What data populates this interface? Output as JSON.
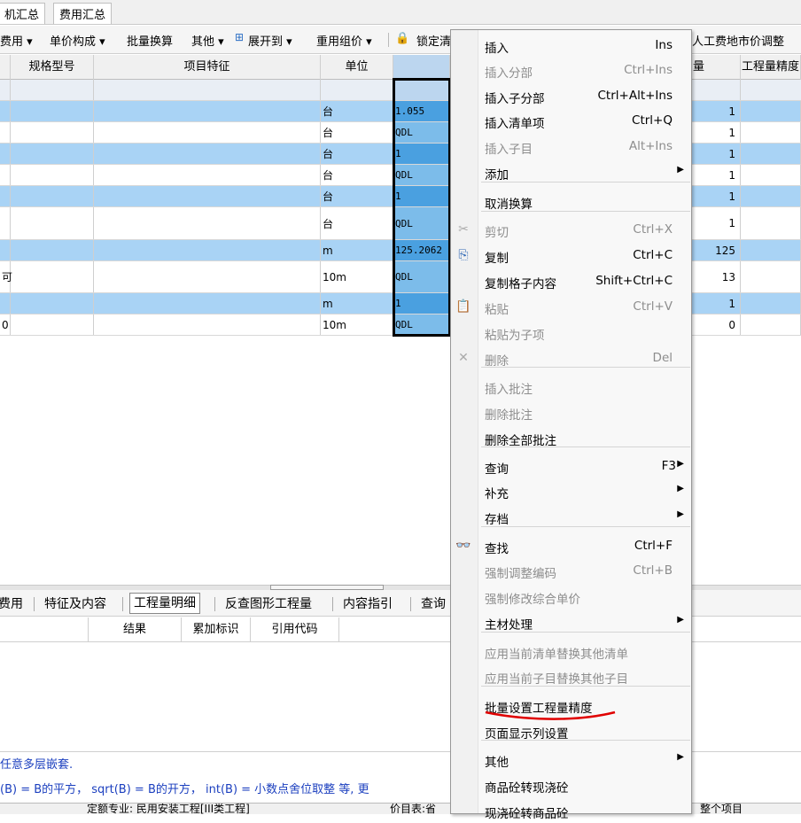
{
  "tabs": [
    "机汇总",
    "费用汇总"
  ],
  "toolbar": {
    "items": [
      "费用 ▾",
      "单价构成 ▾",
      "批量换算",
      "其他 ▾",
      "展开到 ▾",
      "重用组价 ▾",
      "锁定清",
      "人工费地市价调整"
    ]
  },
  "grid": {
    "headers": {
      "spec": "规格型号",
      "feature": "项目特征",
      "unit": "单位",
      "qty": "量",
      "precision": "工程量精度"
    },
    "rows": [
      {
        "left": "",
        "unit": "台",
        "expr": "1.055",
        "qty": "1",
        "style": "blue"
      },
      {
        "left": "",
        "unit": "台",
        "expr": "QDL",
        "qty": "1",
        "style": "white"
      },
      {
        "left": "",
        "unit": "台",
        "expr": "1",
        "qty": "1",
        "style": "blue"
      },
      {
        "left": "",
        "unit": "台",
        "expr": "QDL",
        "qty": "1",
        "style": "white"
      },
      {
        "left": "",
        "unit": "台",
        "expr": "1",
        "qty": "1",
        "style": "blue"
      },
      {
        "left": "",
        "unit": "台",
        "expr": "QDL",
        "qty": "1",
        "style": "white"
      },
      {
        "left": "",
        "unit": "m",
        "expr": "125.2062",
        "qty": "125",
        "style": "blue"
      },
      {
        "left": "可",
        "unit": "10m",
        "expr": "QDL",
        "qty": "13",
        "style": "white"
      },
      {
        "left": "",
        "unit": "m",
        "expr": "1",
        "qty": "1",
        "style": "blue"
      },
      {
        "left": "0",
        "unit": "10m",
        "expr": "QDL",
        "qty": "0",
        "style": "white"
      }
    ]
  },
  "bottom": {
    "tabs": [
      "费用",
      "特征及内容",
      "工程量明细",
      "反查图形工程量",
      "内容指引",
      "查询"
    ],
    "headers": [
      "结果",
      "累加标识",
      "引用代码"
    ],
    "hint1": "任意多层嵌套.",
    "hint2": "(B) = B的平方，  sqrt(B) = B的开方，  int(B) = 小数点舍位取整 等, 更",
    "status1": "定额专业: 民用安装工程[III类工程]",
    "status2": "价目表:省",
    "status3": "整个项目"
  },
  "context_menu": {
    "items": [
      {
        "label": "插入",
        "shortcut": "Ins",
        "disabled": false
      },
      {
        "label": "插入分部",
        "shortcut": "Ctrl+Ins",
        "disabled": true
      },
      {
        "label": "插入子分部",
        "shortcut": "Ctrl+Alt+Ins",
        "disabled": false
      },
      {
        "label": "插入清单项",
        "shortcut": "Ctrl+Q",
        "disabled": false
      },
      {
        "label": "插入子目",
        "shortcut": "Alt+Ins",
        "disabled": true
      },
      {
        "label": "添加",
        "shortcut": "",
        "disabled": false
      },
      {
        "label": "取消换算",
        "shortcut": "",
        "disabled": false
      },
      {
        "label": "剪切",
        "shortcut": "Ctrl+X",
        "disabled": true
      },
      {
        "label": "复制",
        "shortcut": "Ctrl+C",
        "disabled": false
      },
      {
        "label": "复制格子内容",
        "shortcut": "Shift+Ctrl+C",
        "disabled": false
      },
      {
        "label": "粘贴",
        "shortcut": "Ctrl+V",
        "disabled": true
      },
      {
        "label": "粘贴为子项",
        "shortcut": "",
        "disabled": true
      },
      {
        "label": "删除",
        "shortcut": "Del",
        "disabled": true
      },
      {
        "label": "插入批注",
        "shortcut": "",
        "disabled": true
      },
      {
        "label": "删除批注",
        "shortcut": "",
        "disabled": true
      },
      {
        "label": "删除全部批注",
        "shortcut": "",
        "disabled": false
      },
      {
        "label": "查询",
        "shortcut": "F3",
        "disabled": false
      },
      {
        "label": "补充",
        "shortcut": "",
        "disabled": false
      },
      {
        "label": "存档",
        "shortcut": "",
        "disabled": false
      },
      {
        "label": "查找",
        "shortcut": "Ctrl+F",
        "disabled": false
      },
      {
        "label": "强制调整编码",
        "shortcut": "Ctrl+B",
        "disabled": true
      },
      {
        "label": "强制修改综合单价",
        "shortcut": "",
        "disabled": true
      },
      {
        "label": "主材处理",
        "shortcut": "",
        "disabled": false
      },
      {
        "label": "应用当前清单替换其他清单",
        "shortcut": "",
        "disabled": true
      },
      {
        "label": "应用当前子目替换其他子目",
        "shortcut": "",
        "disabled": true
      },
      {
        "label": "批量设置工程量精度",
        "shortcut": "",
        "disabled": false
      },
      {
        "label": "页面显示列设置",
        "shortcut": "",
        "disabled": false
      },
      {
        "label": "其他",
        "shortcut": "",
        "disabled": false
      },
      {
        "label": "商品砼转现浇砼",
        "shortcut": "",
        "disabled": false
      },
      {
        "label": "现浇砼转商品砼",
        "shortcut": "",
        "disabled": false
      }
    ]
  },
  "colors": {
    "row_blue": "#a9d3f5",
    "selected": "#4aa0e0",
    "underline": "#e00000"
  }
}
